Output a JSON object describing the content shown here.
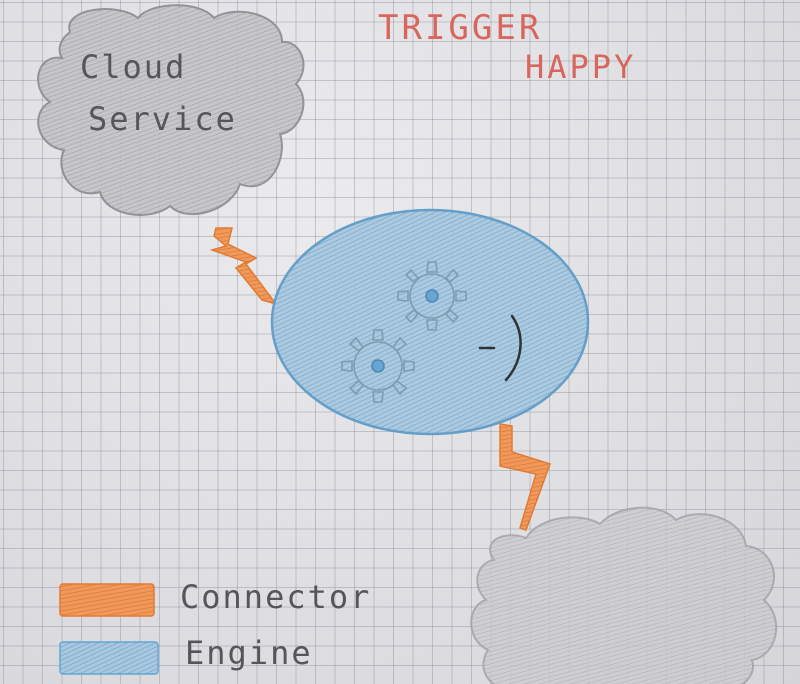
{
  "title": {
    "line1": "TRIGGER",
    "line2": "HAPPY",
    "color": "#d9665c"
  },
  "nodes": {
    "cloud_service": {
      "label_line1": "Cloud",
      "label_line2": "Service",
      "shape": "cloud",
      "fill": "#b9b9bd"
    },
    "engine": {
      "shape": "ellipse",
      "fill": "#8fb8d6",
      "icon": "gears-icon",
      "mark": "-)"
    },
    "cloud_bottom": {
      "label": "",
      "shape": "cloud",
      "fill": "#c2c2c6"
    }
  },
  "edges": [
    {
      "from": "cloud_service",
      "to": "engine",
      "type": "connector",
      "icon": "lightning-bolt-icon",
      "color": "#e8803a"
    },
    {
      "from": "engine",
      "to": "cloud_bottom",
      "type": "connector",
      "icon": "lightning-bolt-icon",
      "color": "#e8803a"
    }
  ],
  "legend": {
    "items": [
      {
        "label": "Connector",
        "color": "#e8803a"
      },
      {
        "label": "Engine",
        "color": "#5fa7d4"
      }
    ]
  }
}
